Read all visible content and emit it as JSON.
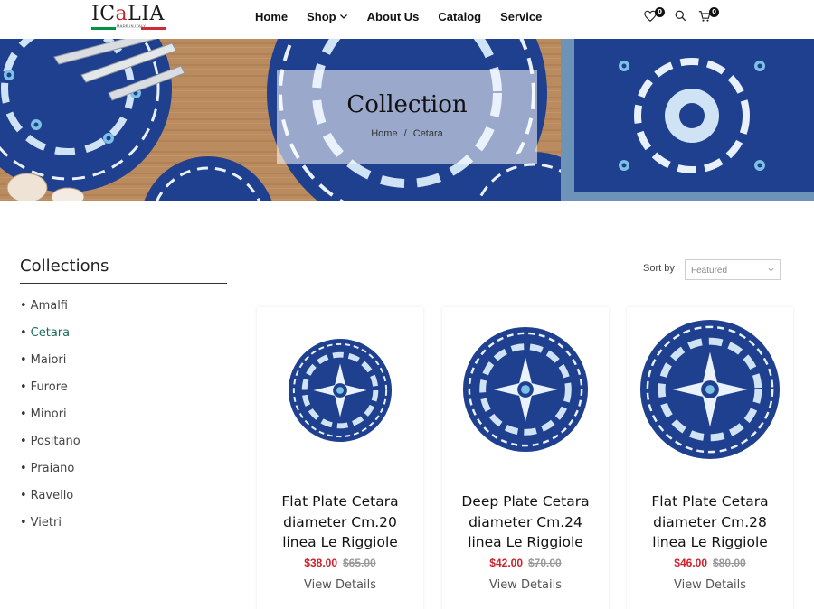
{
  "brand": {
    "logo_text_start": "IC",
    "logo_text_accent": "a",
    "logo_text_end": "LIA",
    "logo_tagline": "MADE IN ITALY",
    "flag_colors": [
      "#009246",
      "#ffffff",
      "#ce2b37"
    ]
  },
  "nav": {
    "items": [
      {
        "label": "Home"
      },
      {
        "label": "Shop"
      },
      {
        "label": "About Us"
      },
      {
        "label": "Catalog"
      },
      {
        "label": "Service"
      }
    ]
  },
  "header_icons": {
    "wishlist_count": "0",
    "cart_count": "0"
  },
  "hero": {
    "title": "Collection",
    "breadcrumb": {
      "home": "Home",
      "separator": "/",
      "current": "Cetara"
    }
  },
  "sidebar": {
    "title": "Collections",
    "items": [
      {
        "label": "Amalfi"
      },
      {
        "label": "Cetara"
      },
      {
        "label": "Maiori"
      },
      {
        "label": "Furore"
      },
      {
        "label": "Minori"
      },
      {
        "label": "Positano"
      },
      {
        "label": "Praiano"
      },
      {
        "label": "Ravello"
      },
      {
        "label": "Vietri"
      }
    ]
  },
  "sort": {
    "label": "Sort by",
    "selected": "Featured"
  },
  "products": [
    {
      "name_line1": "Flat Plate Cetara",
      "name_line2": "diameter Cm.20",
      "name_line3": "linea Le Riggiole",
      "price": "$38.00",
      "old_price": "$65.00",
      "cta": "View Details"
    },
    {
      "name_line1": "Deep Plate Cetara",
      "name_line2": "diameter Cm.24",
      "name_line3": "linea Le Riggiole",
      "price": "$42.00",
      "old_price": "$70.00",
      "cta": "View Details"
    },
    {
      "name_line1": "Flat Plate Cetara",
      "name_line2": "diameter Cm.28",
      "name_line3": "linea Le Riggiole",
      "price": "$46.00",
      "old_price": "$80.00",
      "cta": "View Details"
    }
  ],
  "colors": {
    "accent_green": "#1f6b5a",
    "sale_red": "#d0202b",
    "plate_blue": "#1f3f8f"
  }
}
